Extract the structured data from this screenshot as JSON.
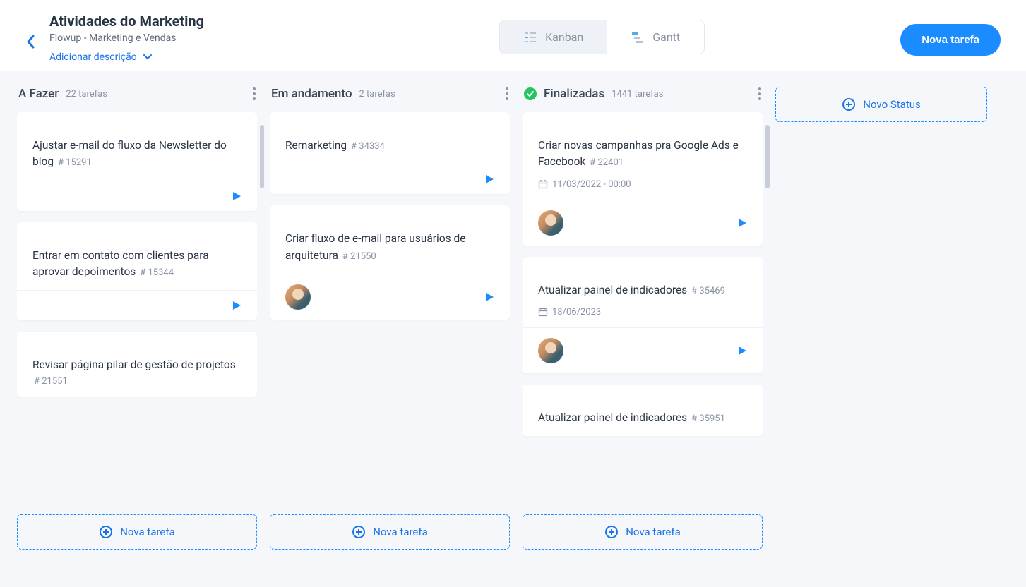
{
  "header": {
    "title": "Atividades do Marketing",
    "subtitle": "Flowup - Marketing e Vendas",
    "add_description": "Adicionar descrição",
    "view_kanban": "Kanban",
    "view_gantt": "Gantt",
    "new_task_btn": "Nova tarefa"
  },
  "columns": [
    {
      "title": "A Fazer",
      "count": "22 tarefas",
      "done": false,
      "cards": [
        {
          "title": "Ajustar e-mail do fluxo da Newsletter do blog",
          "id": "# 15291",
          "date": "",
          "avatar": false
        },
        {
          "title": "Entrar em contato com clientes para aprovar depoimentos",
          "id": "# 15344",
          "date": "",
          "avatar": false
        },
        {
          "title": "Revisar página pilar de gestão de projetos",
          "id": "# 21551",
          "date": "",
          "avatar": false
        }
      ]
    },
    {
      "title": "Em andamento",
      "count": "2 tarefas",
      "done": false,
      "cards": [
        {
          "title": "Remarketing",
          "id": "# 34334",
          "date": "",
          "avatar": false
        },
        {
          "title": "Criar fluxo de e-mail para usuários de arquitetura",
          "id": "# 21550",
          "date": "",
          "avatar": true
        }
      ]
    },
    {
      "title": "Finalizadas",
      "count": "1441 tarefas",
      "done": true,
      "cards": [
        {
          "title": "Criar novas campanhas pra Google Ads e Facebook",
          "id": "# 22401",
          "date": "11/03/2022 - 00:00",
          "avatar": true
        },
        {
          "title": "Atualizar painel de indicadores",
          "id": "# 35469",
          "date": "18/06/2023",
          "avatar": true
        },
        {
          "title": "Atualizar painel de indicadores",
          "id": "# 35951",
          "date": "",
          "avatar": false
        }
      ]
    }
  ],
  "labels": {
    "new_task": "Nova tarefa",
    "new_status": "Novo Status"
  }
}
